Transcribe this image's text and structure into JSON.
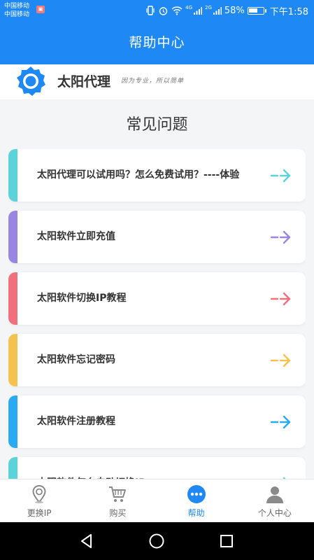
{
  "status_bar": {
    "carrier_1": "中国移动",
    "carrier_2": "中国移动",
    "net_1": "4G",
    "net_2": "2G",
    "battery": "58%",
    "time": "下午1:58"
  },
  "header": {
    "title": "帮助中心"
  },
  "brand": {
    "name": "太阳代理",
    "slogan": "因为专业，所以简单"
  },
  "faq": {
    "title": "常见问题",
    "items": [
      {
        "label": "太阳代理可以试用吗？怎么免费试用？----体验",
        "color": "#5bd3d9"
      },
      {
        "label": "太阳软件立即充值",
        "color": "#9a86e0"
      },
      {
        "label": "太阳软件切换IP教程",
        "color": "#f0707e"
      },
      {
        "label": "太阳软件忘记密码",
        "color": "#f6c24f"
      },
      {
        "label": "太阳软件注册教程",
        "color": "#2aaaf0"
      },
      {
        "label": "太阳软件怎么自动切换IP",
        "color": "#5bd3d9"
      }
    ]
  },
  "tabs": [
    {
      "label": "更换IP",
      "icon": "location-pin-icon"
    },
    {
      "label": "购买",
      "icon": "cart-icon"
    },
    {
      "label": "帮助",
      "icon": "more-dots-icon",
      "active": true
    },
    {
      "label": "个人中心",
      "icon": "person-icon"
    }
  ],
  "colors": {
    "primary": "#1e88f5"
  }
}
